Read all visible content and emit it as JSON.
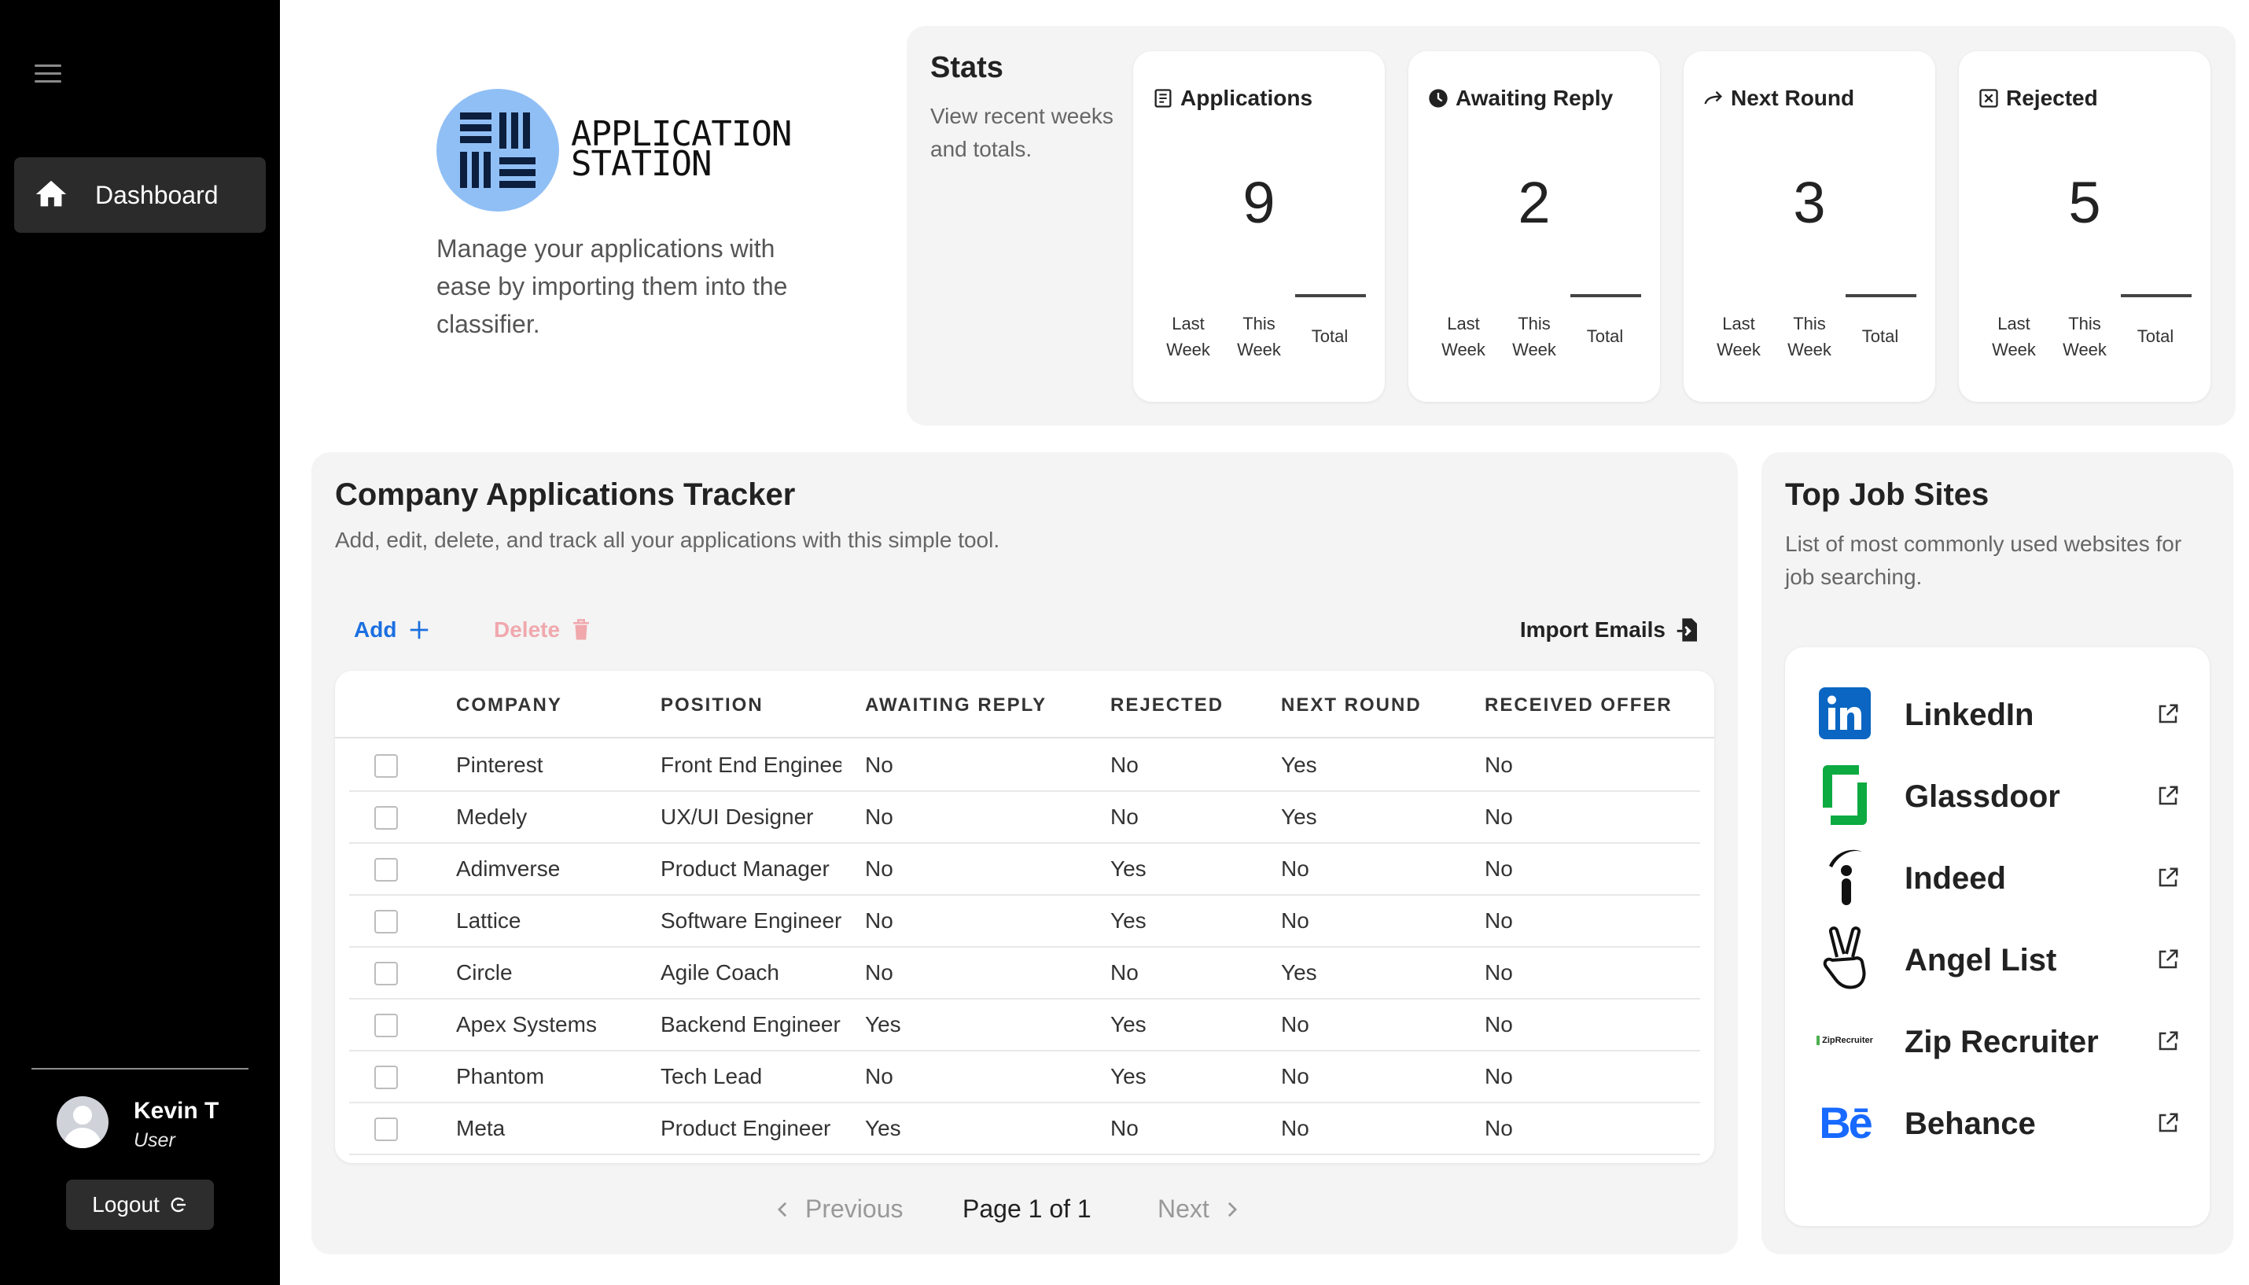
{
  "sidebar": {
    "nav": [
      {
        "label": "Dashboard",
        "icon": "home-icon"
      }
    ],
    "user": {
      "name": "Kevin T",
      "role": "User"
    },
    "logout_label": "Logout"
  },
  "brand": {
    "name_line1": "APPLICATION",
    "name_line2": "STATION",
    "description": "Manage your applications with ease by importing them into the classifier.",
    "logo_color": "#90bff5"
  },
  "stats": {
    "title": "Stats",
    "description": "View recent weeks and totals.",
    "col_last_1": "Last",
    "col_last_2": "Week",
    "col_this_1": "This",
    "col_this_2": "Week",
    "col_total": "Total",
    "cards": [
      {
        "label": "Applications",
        "icon": "document-icon",
        "value": "9"
      },
      {
        "label": "Awaiting Reply",
        "icon": "clock-icon",
        "value": "2"
      },
      {
        "label": "Next Round",
        "icon": "arrow-right-icon",
        "value": "3"
      },
      {
        "label": "Rejected",
        "icon": "x-box-icon",
        "value": "5"
      }
    ]
  },
  "tracker": {
    "title": "Company Applications Tracker",
    "description": "Add, edit, delete, and track all your applications with this simple tool.",
    "add_label": "Add",
    "delete_label": "Delete",
    "import_label": "Import Emails",
    "columns": [
      "COMPANY",
      "POSITION",
      "AWAITING REPLY",
      "REJECTED",
      "NEXT ROUND",
      "RECEIVED OFFER"
    ],
    "rows": [
      {
        "company": "Pinterest",
        "position": "Front End Engineer",
        "awaiting": "No",
        "rejected": "No",
        "next": "Yes",
        "offer": "No"
      },
      {
        "company": "Medely",
        "position": "UX/UI Designer",
        "awaiting": "No",
        "rejected": "No",
        "next": "Yes",
        "offer": "No"
      },
      {
        "company": "Adimverse",
        "position": "Product Manager",
        "awaiting": "No",
        "rejected": "Yes",
        "next": "No",
        "offer": "No"
      },
      {
        "company": "Lattice",
        "position": "Software Engineer",
        "awaiting": "No",
        "rejected": "Yes",
        "next": "No",
        "offer": "No"
      },
      {
        "company": "Circle",
        "position": "Agile Coach",
        "awaiting": "No",
        "rejected": "No",
        "next": "Yes",
        "offer": "No"
      },
      {
        "company": "Apex Systems",
        "position": "Backend Engineer",
        "awaiting": "Yes",
        "rejected": "Yes",
        "next": "No",
        "offer": "No"
      },
      {
        "company": "Phantom",
        "position": "Tech Lead",
        "awaiting": "No",
        "rejected": "Yes",
        "next": "No",
        "offer": "No"
      },
      {
        "company": "Meta",
        "position": "Product Engineer",
        "awaiting": "Yes",
        "rejected": "No",
        "next": "No",
        "offer": "No"
      }
    ],
    "pager": {
      "previous": "Previous",
      "info": "Page 1 of 1",
      "next": "Next"
    }
  },
  "job_sites": {
    "title": "Top Job Sites",
    "description": "List of most commonly used websites for job searching.",
    "sites": [
      {
        "name": "LinkedIn",
        "icon": "linkedin-icon",
        "color": "#0a66c2"
      },
      {
        "name": "Glassdoor",
        "icon": "glassdoor-icon",
        "color": "#0caa41"
      },
      {
        "name": "Indeed",
        "icon": "indeed-icon",
        "color": "#111111"
      },
      {
        "name": "Angel List",
        "icon": "angellist-icon",
        "color": "#111111"
      },
      {
        "name": "Zip Recruiter",
        "icon": "ziprecruiter-icon",
        "color": "#4caf50",
        "logo_text": "ZipRecruiter"
      },
      {
        "name": "Behance",
        "icon": "behance-icon",
        "color": "#1769ff",
        "logo_text": "Bē"
      }
    ]
  }
}
